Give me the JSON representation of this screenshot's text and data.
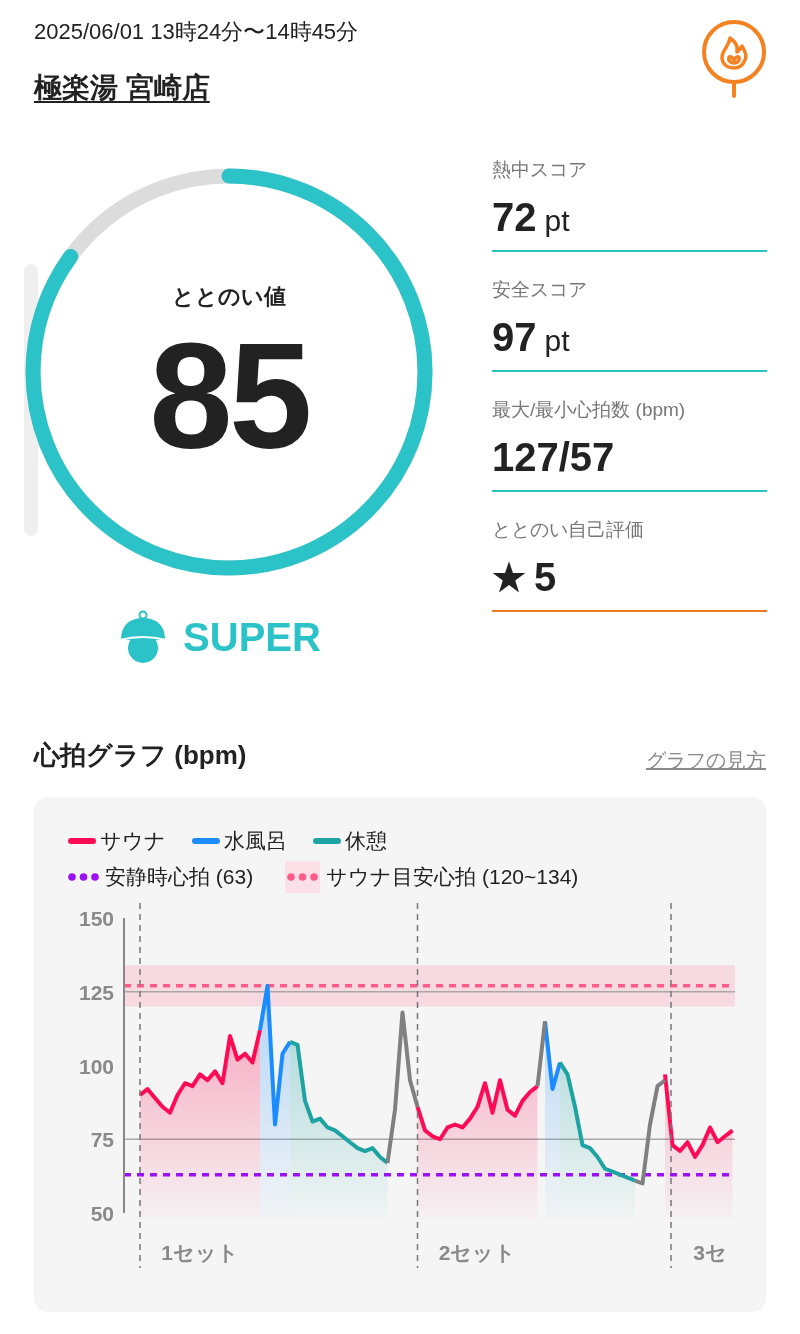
{
  "header": {
    "datetime": "2025/06/01 13時24分〜14時45分",
    "store": "極楽湯 宮崎店"
  },
  "gauge": {
    "label": "ととのい値",
    "value": "85",
    "level": 0.85,
    "rank": "SUPER"
  },
  "metrics": [
    {
      "kind": "score",
      "label": "熱中スコア",
      "value": "72",
      "unit": "pt"
    },
    {
      "kind": "score",
      "label": "安全スコア",
      "value": "97",
      "unit": "pt"
    },
    {
      "kind": "score",
      "label": "最大/最小心拍数 (bpm)",
      "value": "127/57"
    },
    {
      "kind": "rating",
      "label": "ととのい自己評価",
      "value": "5"
    }
  ],
  "graph": {
    "title": "心拍グラフ (bpm)",
    "help_link": "グラフの見方",
    "chart_data": {
      "type": "area",
      "ylim": [
        50,
        150
      ],
      "yticks": [
        50,
        75,
        100,
        125,
        150
      ],
      "categories": [
        null,
        null,
        null,
        null,
        null,
        null,
        null,
        null,
        "1セット",
        null,
        null,
        null,
        null,
        null,
        null,
        null,
        null,
        null,
        null,
        null,
        null,
        null,
        null,
        null,
        null,
        null,
        null,
        null,
        null,
        null,
        null,
        null,
        null,
        null,
        null,
        null,
        null,
        null,
        null,
        null,
        null,
        null,
        null,
        null,
        null,
        "2セット",
        null,
        null,
        null,
        null,
        null,
        null,
        null,
        null,
        null,
        null,
        null,
        null,
        null,
        null,
        null,
        null,
        null,
        null,
        null,
        null,
        null,
        null,
        null,
        null,
        null,
        null,
        null,
        null,
        null,
        null,
        "3セ",
        null,
        null,
        null
      ],
      "series": [
        {
          "name": "サウナ",
          "color": "#ff0a55",
          "values": [
            90,
            92,
            89,
            86,
            84,
            90,
            94,
            93,
            97,
            95,
            98,
            94,
            110,
            102,
            104,
            101,
            112,
            null,
            null,
            null,
            null,
            null,
            null,
            null,
            null,
            null,
            null,
            null,
            null,
            null,
            null,
            null,
            null,
            null,
            null,
            null,
            null,
            86,
            78,
            76,
            75,
            79,
            80,
            79,
            82,
            86,
            94,
            84,
            95,
            85,
            83,
            88,
            91,
            93,
            null,
            null,
            null,
            null,
            null,
            null,
            null,
            null,
            null,
            null,
            null,
            null,
            null,
            null,
            null,
            null,
            97,
            73,
            71,
            74,
            69,
            73,
            79,
            74,
            76,
            78
          ]
        },
        {
          "name": "水風呂",
          "color": "#1a8cff",
          "values": [
            null,
            null,
            null,
            null,
            null,
            null,
            null,
            null,
            null,
            null,
            null,
            null,
            null,
            null,
            null,
            null,
            112,
            127,
            80,
            104,
            108,
            null,
            null,
            null,
            null,
            null,
            null,
            null,
            null,
            null,
            null,
            null,
            null,
            null,
            null,
            null,
            null,
            null,
            null,
            null,
            null,
            null,
            null,
            null,
            null,
            null,
            null,
            null,
            null,
            null,
            null,
            null,
            null,
            null,
            115,
            92,
            101,
            null,
            null,
            null,
            null,
            null,
            null,
            null,
            null,
            null,
            null,
            null,
            null,
            null,
            null,
            null,
            null,
            null,
            null,
            null,
            null,
            null,
            null,
            null
          ]
        },
        {
          "name": "休憩",
          "color": "#1ea3a3",
          "values": [
            null,
            null,
            null,
            null,
            null,
            null,
            null,
            null,
            null,
            null,
            null,
            null,
            null,
            null,
            null,
            null,
            null,
            null,
            null,
            null,
            108,
            107,
            88,
            81,
            82,
            79,
            78,
            76,
            74,
            72,
            71,
            72,
            69,
            67,
            null,
            null,
            null,
            null,
            null,
            null,
            null,
            null,
            null,
            null,
            null,
            null,
            null,
            null,
            null,
            null,
            null,
            null,
            null,
            null,
            null,
            null,
            101,
            97,
            86,
            73,
            72,
            69,
            65,
            64,
            63,
            62,
            61,
            null,
            null,
            null,
            null,
            null,
            null,
            null,
            null,
            null,
            null,
            null,
            null,
            null
          ]
        },
        {
          "type": "line",
          "color": "#808080",
          "values": [
            null,
            null,
            null,
            null,
            null,
            null,
            null,
            null,
            null,
            null,
            null,
            null,
            null,
            null,
            null,
            null,
            null,
            null,
            null,
            null,
            null,
            null,
            null,
            null,
            null,
            null,
            null,
            null,
            null,
            null,
            null,
            null,
            null,
            67,
            85,
            118,
            95,
            86,
            null,
            null,
            null,
            null,
            null,
            null,
            null,
            null,
            null,
            null,
            null,
            null,
            null,
            null,
            null,
            93,
            115,
            null,
            null,
            null,
            null,
            null,
            null,
            null,
            null,
            null,
            null,
            null,
            null,
            null,
            null,
            null,
            null,
            null,
            null,
            null,
            null,
            null,
            null,
            null,
            null,
            null
          ]
        },
        {
          "type": "line",
          "color": "#808080",
          "values": [
            null,
            null,
            null,
            null,
            null,
            null,
            null,
            null,
            null,
            null,
            null,
            null,
            null,
            null,
            null,
            null,
            null,
            null,
            null,
            null,
            null,
            null,
            null,
            null,
            null,
            null,
            null,
            null,
            null,
            null,
            null,
            null,
            null,
            null,
            null,
            null,
            null,
            null,
            null,
            null,
            null,
            null,
            null,
            null,
            null,
            null,
            null,
            null,
            null,
            null,
            null,
            null,
            null,
            null,
            null,
            null,
            null,
            null,
            null,
            null,
            null,
            null,
            null,
            null,
            null,
            null,
            61,
            60,
            80,
            93,
            95,
            null,
            null,
            null,
            null,
            null,
            null,
            null,
            null,
            null
          ]
        }
      ],
      "ref_lines": [
        {
          "axis": "y",
          "value": 63,
          "label": "安静時心拍 (63)",
          "color": "#9b10f5"
        },
        {
          "axis": "y",
          "value": 127,
          "color": "#ff5c8a"
        }
      ],
      "bands": [
        {
          "axis": "y",
          "from": 120,
          "to": 134,
          "label": "サウナ目安心拍 (120~134)",
          "color": "#ff5c8a"
        }
      ]
    }
  }
}
